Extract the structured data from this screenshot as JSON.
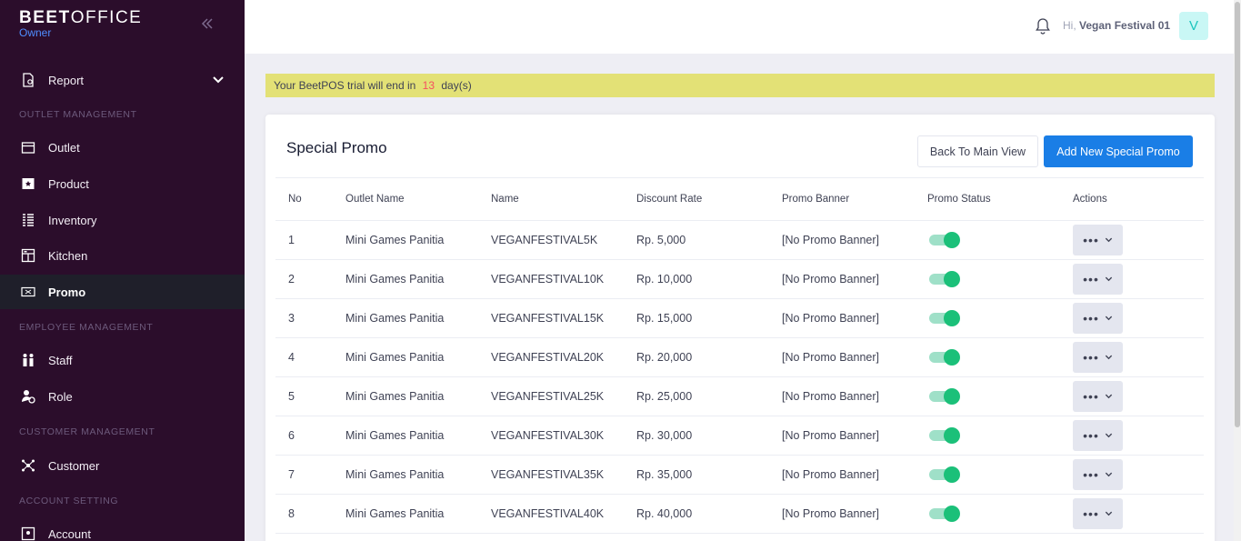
{
  "brand": {
    "name_bold": "BEET",
    "name_light": "OFFICE",
    "role": "Owner"
  },
  "sidebar": {
    "report": "Report",
    "sections": {
      "outlet": "OUTLET MANAGEMENT",
      "employee": "EMPLOYEE MANAGEMENT",
      "customer": "CUSTOMER MANAGEMENT",
      "account": "ACCOUNT SETTING"
    },
    "items": {
      "outlet": "Outlet",
      "product": "Product",
      "inventory": "Inventory",
      "kitchen": "Kitchen",
      "promo": "Promo",
      "staff": "Staff",
      "role": "Role",
      "customer": "Customer",
      "account": "Account"
    }
  },
  "header": {
    "greeting": "Hi,",
    "user": "Vegan Festival 01",
    "avatar": "V"
  },
  "trial": {
    "prefix": "Your BeetPOS trial will end in",
    "days": "13",
    "suffix": "day(s)"
  },
  "page": {
    "title": "Special Promo",
    "back_button": "Back To Main View",
    "add_button": "Add New Special Promo"
  },
  "table": {
    "headers": {
      "no": "No",
      "outlet": "Outlet Name",
      "name": "Name",
      "rate": "Discount Rate",
      "banner": "Promo Banner",
      "status": "Promo Status",
      "actions": "Actions"
    },
    "rows": [
      {
        "no": "1",
        "outlet": "Mini Games Panitia",
        "name": "VEGANFESTIVAL5K",
        "rate": "Rp. 5,000",
        "banner": "[No Promo Banner]",
        "status": true
      },
      {
        "no": "2",
        "outlet": "Mini Games Panitia",
        "name": "VEGANFESTIVAL10K",
        "rate": "Rp. 10,000",
        "banner": "[No Promo Banner]",
        "status": true
      },
      {
        "no": "3",
        "outlet": "Mini Games Panitia",
        "name": "VEGANFESTIVAL15K",
        "rate": "Rp. 15,000",
        "banner": "[No Promo Banner]",
        "status": true
      },
      {
        "no": "4",
        "outlet": "Mini Games Panitia",
        "name": "VEGANFESTIVAL20K",
        "rate": "Rp. 20,000",
        "banner": "[No Promo Banner]",
        "status": true
      },
      {
        "no": "5",
        "outlet": "Mini Games Panitia",
        "name": "VEGANFESTIVAL25K",
        "rate": "Rp. 25,000",
        "banner": "[No Promo Banner]",
        "status": true
      },
      {
        "no": "6",
        "outlet": "Mini Games Panitia",
        "name": "VEGANFESTIVAL30K",
        "rate": "Rp. 30,000",
        "banner": "[No Promo Banner]",
        "status": true
      },
      {
        "no": "7",
        "outlet": "Mini Games Panitia",
        "name": "VEGANFESTIVAL35K",
        "rate": "Rp. 35,000",
        "banner": "[No Promo Banner]",
        "status": true
      },
      {
        "no": "8",
        "outlet": "Mini Games Panitia",
        "name": "VEGANFESTIVAL40K",
        "rate": "Rp. 40,000",
        "banner": "[No Promo Banner]",
        "status": true
      }
    ]
  },
  "colors": {
    "sidebar_bg": "#2b0d2b",
    "accent": "#1a7ee6",
    "toggle_on": "#1bc079",
    "trial_bg": "#e3e176",
    "days": "#f64e60"
  }
}
